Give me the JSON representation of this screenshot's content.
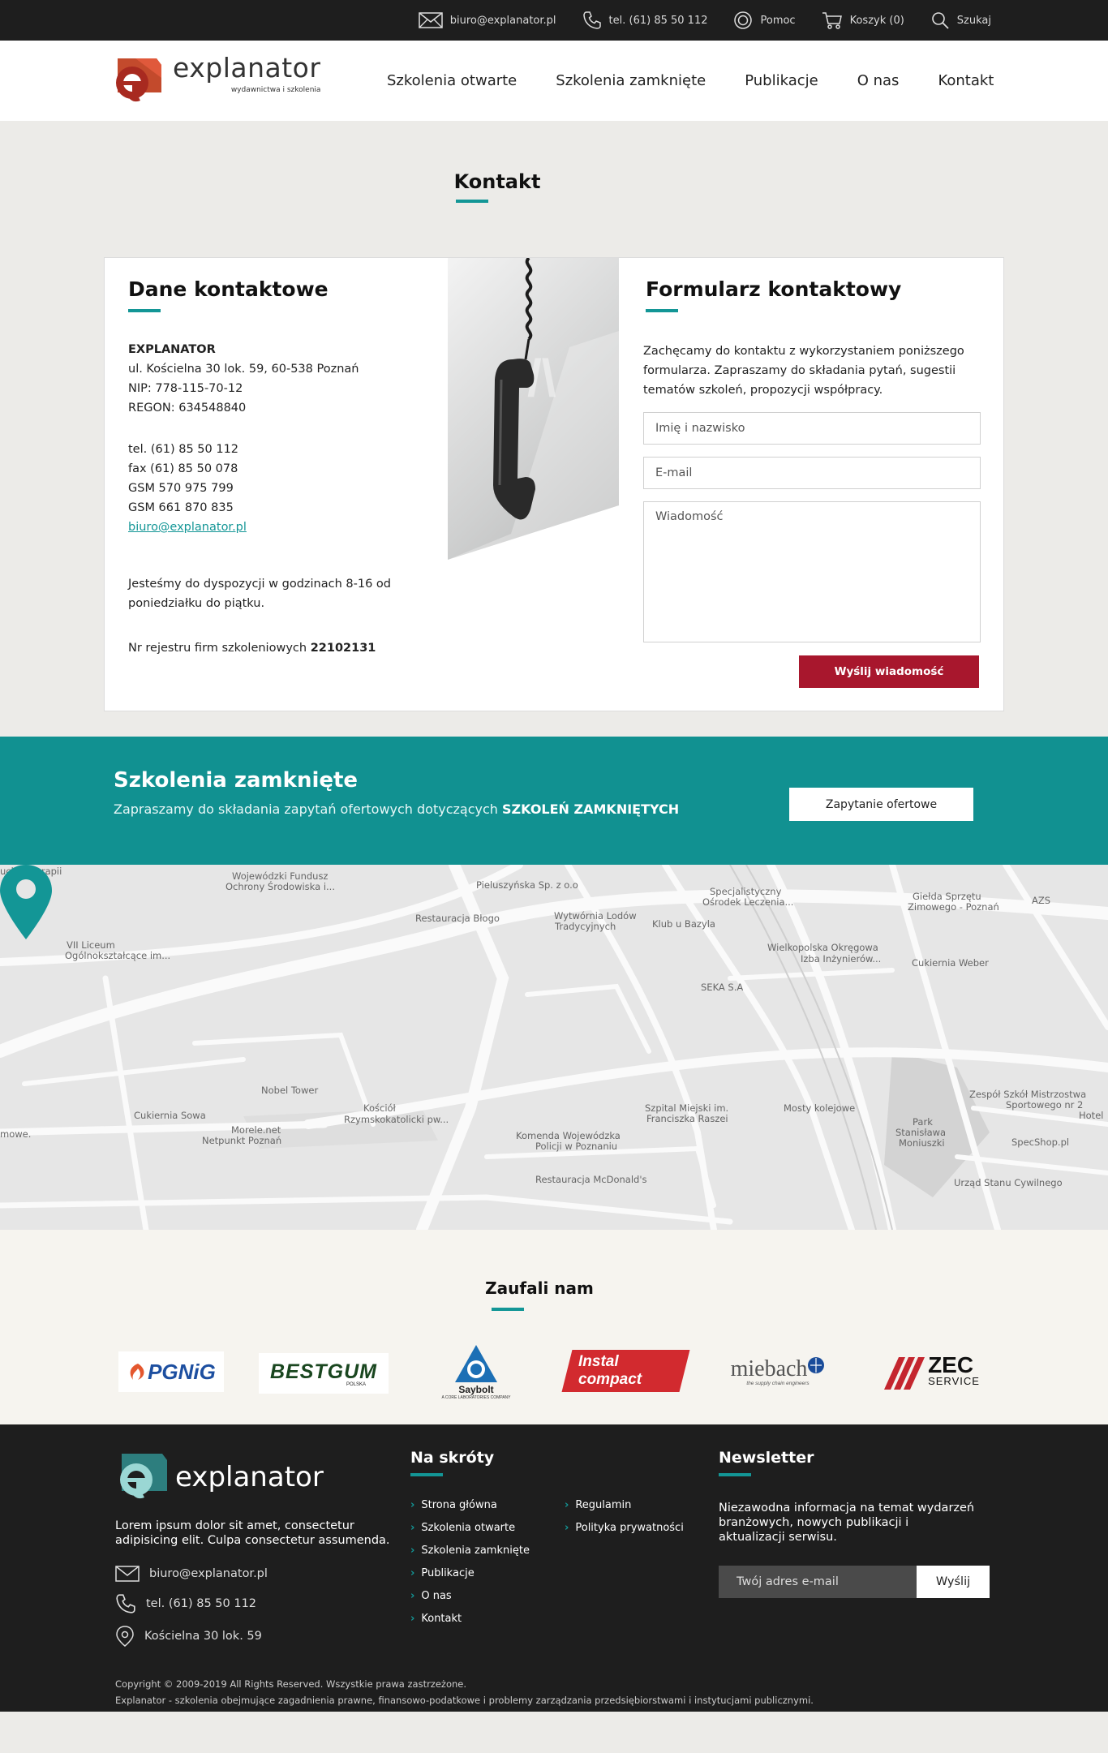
{
  "topbar": {
    "email": "biuro@explanator.pl",
    "phone": "tel. (61) 85 50 112",
    "help": "Pomoc",
    "cart": "Koszyk (0)",
    "search": "Szukaj"
  },
  "header": {
    "logo_name": "explanator",
    "logo_sub": "wydawnictwa i szkolenia",
    "nav": [
      "Szkolenia otwarte",
      "Szkolenia zamknięte",
      "Publikacje",
      "O nas",
      "Kontakt"
    ]
  },
  "page_title": "Kontakt",
  "contact": {
    "heading": "Dane kontaktowe",
    "company": "EXPLANATOR",
    "address": "ul. Kościelna 30 lok. 59, 60-538 Poznań",
    "nip": "NIP: 778-115-70-12",
    "regon": "REGON: 634548840",
    "tel": "tel. (61) 85 50 112",
    "fax": "fax (61) 85 50 078",
    "gsm1": "GSM 570 975 799",
    "gsm2": "GSM 661 870 835",
    "email": "biuro@explanator.pl",
    "hours_1": "Jesteśmy do dyspozycji w godzinach 8-16 od",
    "hours_2": "poniedziałku do piątku.",
    "registry_label": "Nr rejestru firm szkoleniowych",
    "registry_number": "22102131"
  },
  "form": {
    "heading": "Formularz kontaktowy",
    "intro_1": "Zachęcamy do kontaktu z wykorzystaniem poniższego",
    "intro_2": "formularza. Zapraszamy do składania pytań, sugestii",
    "intro_3": "tematów szkoleń, propozycji współpracy.",
    "name_placeholder": "Imię i nazwisko",
    "email_placeholder": "E-mail",
    "message_placeholder": "Wiadomość",
    "submit": "Wyślij wiadomość"
  },
  "banner": {
    "title": "Szkolenia zamknięte",
    "text": "Zapraszamy do składania zapytań ofertowych dotyczących",
    "text_bold": "SZKOLEŃ ZAMKNIĘTYCH",
    "button": "Zapytanie ofertowe"
  },
  "map": {
    "labels": [
      "uchu i Terapii",
      "Wojewódzki Fundusz",
      "Ochrony Środowiska i...",
      "Pieluszyńska Sp. z o.o",
      "Specjalistyczny",
      "Ośrodek Leczenia...",
      "Giełda Sprzętu",
      "Zimowego - Poznań",
      "AZS",
      "Restauracja Błogo",
      "Wytwórnia Lodów",
      "Tradycyjnych",
      "Klub u Bazyla",
      "VII Liceum",
      "Ogólnokształcące im...",
      "Wielkopolska Okręgowa",
      "Izba Inżynierów...",
      "Cukiernia Weber",
      "SEKA S.A",
      "Nobel Tower",
      "Kościół",
      "Rzymskokatolicki pw...",
      "Cukiernia Sowa",
      "Morele.net",
      "Netpunkt Poznań",
      "Szpital Miejski im.",
      "Franciszka Raszei",
      "Mosty kolejowe",
      "Komenda Wojewódzka",
      "Policji w Poznaniu",
      "Zespół Szkół Mistrzostwa",
      "Sportowego nr 2",
      "Park",
      "Stanisława",
      "Moniuszki",
      "SpecShop.pl",
      "Hotel",
      "mowe.",
      "Restauracja McDonald's",
      "Urząd Stanu Cywilnego"
    ]
  },
  "trusted": {
    "title": "Zaufali nam",
    "logos": [
      "PGNiG",
      "BESTGUM",
      "POLSKA",
      "Saybolt",
      "A CORE LABORATORIES COMPANY",
      "Instal compact",
      "miebach",
      "the supply chain engineers",
      "ZEC",
      "SERVICE"
    ]
  },
  "footer": {
    "logo_name": "explanator",
    "desc_1": "Lorem ipsum dolor sit amet, consectetur",
    "desc_2": "adipisicing elit. Culpa consectetur assumenda.",
    "email": "biuro@explanator.pl",
    "phone": "tel. (61) 85 50 112",
    "address": "Kościelna 30 lok. 59",
    "shortcuts_heading": "Na skróty",
    "shortcuts_col1": [
      "Strona główna",
      "Szkolenia otwarte",
      "Szkolenia zamknięte",
      "Publikacje",
      "O nas",
      "Kontakt"
    ],
    "shortcuts_col2": [
      "Regulamin",
      "Polityka prywatności"
    ],
    "newsletter_heading": "Newsletter",
    "newsletter_text": "Niezawodna informacja na temat wydarzeń branżowych, nowych publikacji i aktualizacji serwisu.",
    "newsletter_placeholder": "Twój adres e-mail",
    "newsletter_button": "Wyślij",
    "copyright_1": "Copyright © 2009-2019 All Rights Reserved. Wszystkie prawa zastrzeżone.",
    "copyright_2": "Explanator - szkolenia obejmujące zagadnienia prawne, finansowo-podatkowe i problemy zarządzania przedsiębiorstwami i instytucjami publicznymi."
  },
  "colors": {
    "accent": "#139696",
    "banner": "#119191",
    "submit": "#a8172d",
    "dark": "#1e1e1e"
  }
}
